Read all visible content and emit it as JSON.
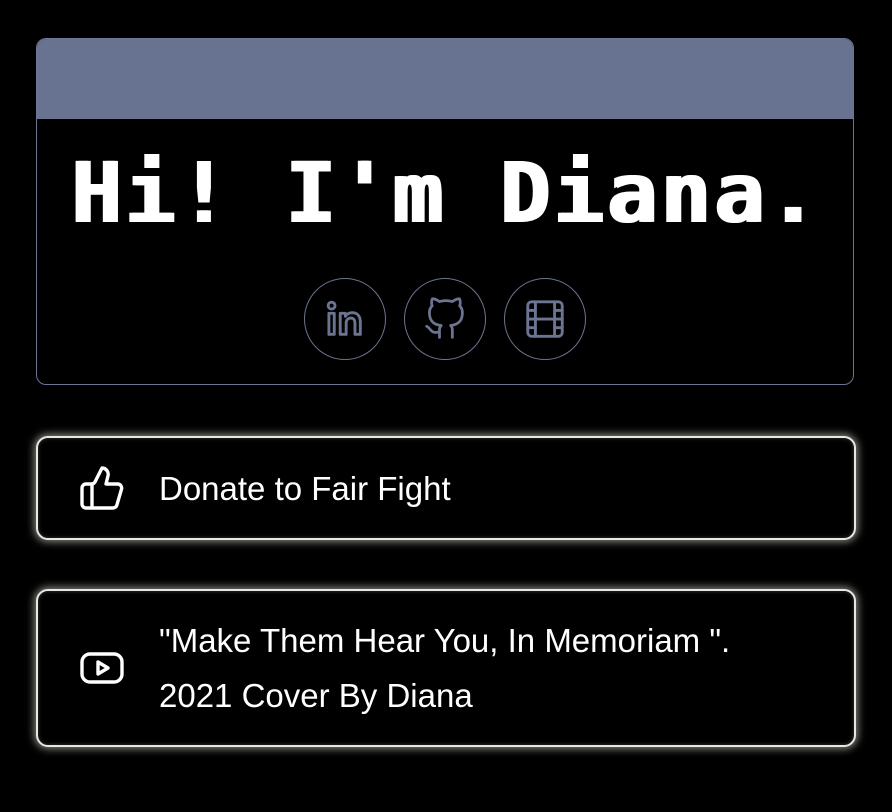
{
  "profile": {
    "title": "Hi! I'm Diana.",
    "banner_color": "#677391",
    "socials": [
      {
        "icon": "linkedin-icon"
      },
      {
        "icon": "github-icon"
      },
      {
        "icon": "film-icon"
      }
    ]
  },
  "links": [
    {
      "icon": "thumbs-up-icon",
      "label": "Donate to Fair Fight"
    },
    {
      "icon": "youtube-icon",
      "label_line1": "\"Make Them Hear You, In Memoriam \".",
      "label_line2": "2021 Cover By Diana"
    }
  ]
}
